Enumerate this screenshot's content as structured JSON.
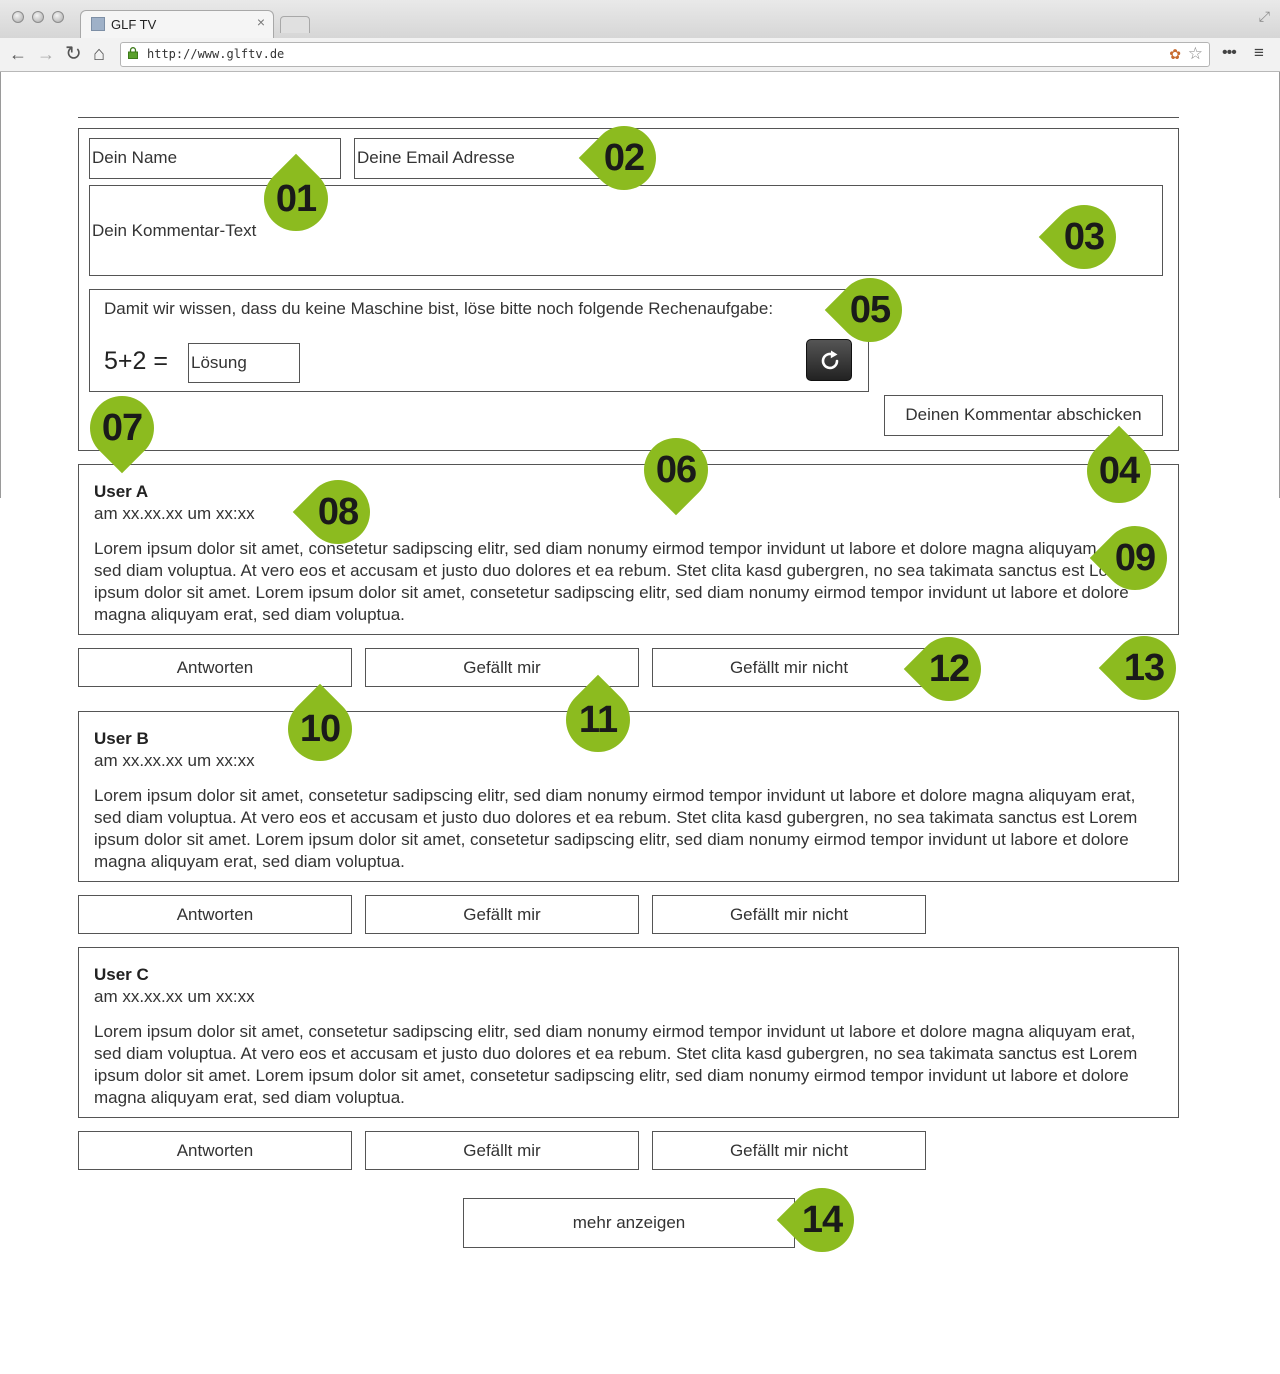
{
  "browser": {
    "tab_title": "GLF TV",
    "tab_close": "×",
    "url": "http://www.glftv.de",
    "back": "←",
    "forward": "→",
    "reload": "↻",
    "home": "⌂",
    "star": "☆",
    "menu_dots": "•••",
    "menu": "≡",
    "resize": "⤢",
    "extension": "✿"
  },
  "form": {
    "name_placeholder": "Dein Name",
    "email_placeholder": "Deine Email Adresse",
    "comment_placeholder": "Dein Kommentar-Text",
    "captcha_prompt": "Damit wir wissen, dass du keine Maschine bist, löse bitte noch folgende Rechenaufgabe:",
    "captcha_equation": "5+2 =",
    "solution_placeholder": "Lösung",
    "submit_label": "Deinen Kommentar abschicken"
  },
  "comments": [
    {
      "user": "User A",
      "date": "am xx.xx.xx um xx:xx",
      "text": "Lorem ipsum dolor sit amet, consetetur sadipscing elitr, sed diam nonumy eirmod tempor invidunt ut labore et dolore magna aliquyam erat, sed diam voluptua. At vero eos et accusam et justo duo dolores et ea rebum. Stet clita kasd gubergren, no sea takimata sanctus est Lorem ipsum dolor sit amet. Lorem ipsum dolor sit amet, consetetur sadipscing elitr, sed diam nonumy eirmod tempor invidunt ut labore et dolore magna aliquyam erat, sed diam voluptua.",
      "reply_label": "Antworten",
      "like_label": "Gefällt mir",
      "dislike_label": "Gefällt mir nicht"
    },
    {
      "user": "User B",
      "date": "am xx.xx.xx um xx:xx",
      "text": "Lorem ipsum dolor sit amet, consetetur sadipscing elitr, sed diam nonumy eirmod tempor invidunt ut labore et dolore magna aliquyam erat, sed diam voluptua. At vero eos et accusam et justo duo dolores et ea rebum. Stet clita kasd gubergren, no sea takimata sanctus est Lorem ipsum dolor sit amet. Lorem ipsum dolor sit amet, consetetur sadipscing elitr, sed diam nonumy eirmod tempor invidunt ut labore et dolore magna aliquyam erat, sed diam voluptua.",
      "reply_label": "Antworten",
      "like_label": "Gefällt mir",
      "dislike_label": "Gefällt mir nicht"
    },
    {
      "user": "User C",
      "date": "am xx.xx.xx um xx:xx",
      "text": "Lorem ipsum dolor sit amet, consetetur sadipscing elitr, sed diam nonumy eirmod tempor invidunt ut labore et dolore magna aliquyam erat, sed diam voluptua. At vero eos et accusam et justo duo dolores et ea rebum. Stet clita kasd gubergren, no sea takimata sanctus est Lorem ipsum dolor sit amet. Lorem ipsum dolor sit amet, consetetur sadipscing elitr, sed diam nonumy eirmod tempor invidunt ut labore et dolore magna aliquyam erat, sed diam voluptua.",
      "reply_label": "Antworten",
      "like_label": "Gefällt mir",
      "dislike_label": "Gefällt mir nicht"
    }
  ],
  "more_label": "mehr anzeigen",
  "markers": [
    "01",
    "02",
    "03",
    "04",
    "05",
    "06",
    "07",
    "08",
    "09",
    "10",
    "11",
    "12",
    "13",
    "14"
  ],
  "colors": {
    "marker": "#8cbb1f"
  }
}
